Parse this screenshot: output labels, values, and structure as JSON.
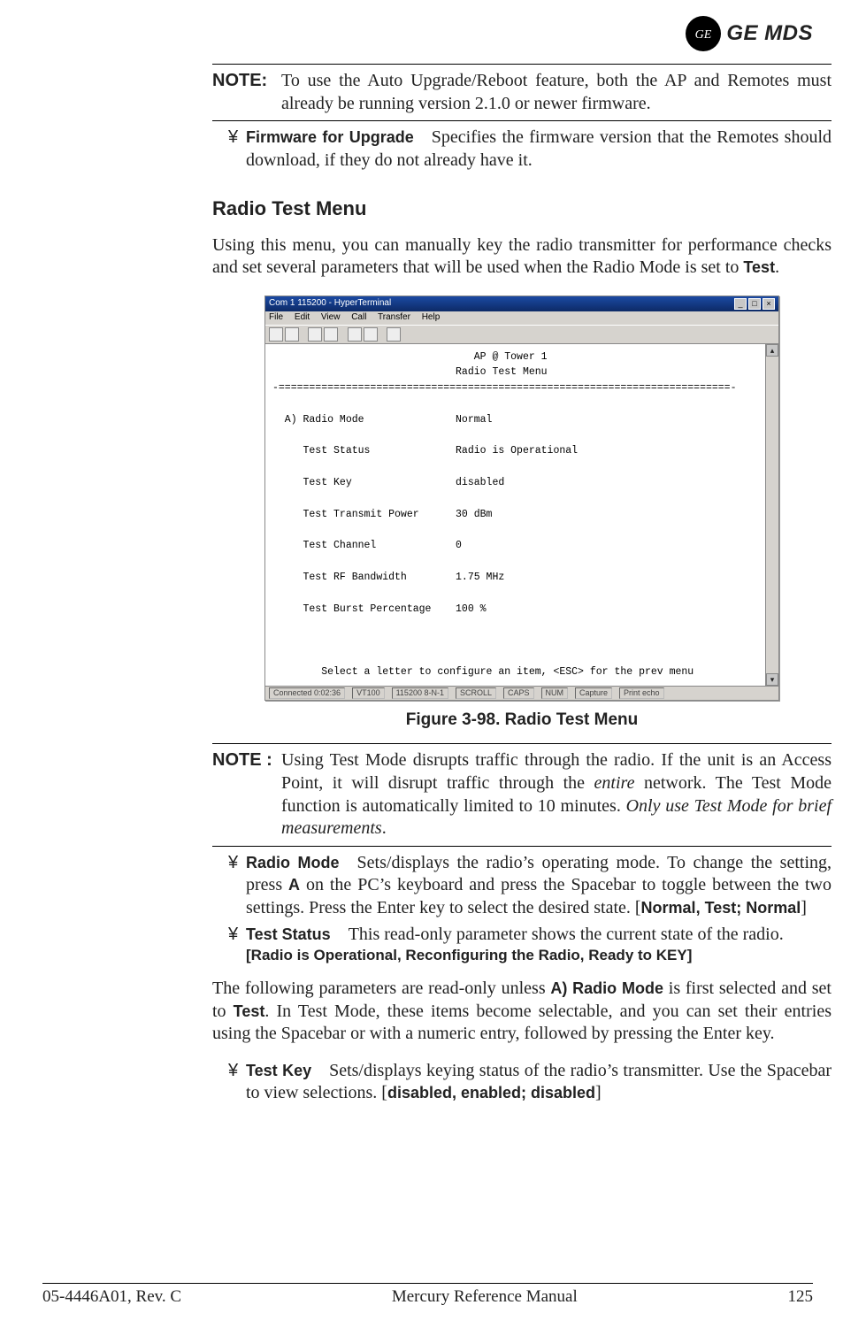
{
  "header": {
    "brand": "GE MDS"
  },
  "note1": {
    "label": "NOTE:",
    "text": "To use the Auto Upgrade/Reboot feature, both the AP and Remotes must already be running version 2.1.0 or newer firm­ware."
  },
  "bullet_fw": {
    "name": "Firmware for Upgrade",
    "desc": "Specifies the firmware version that the Remotes should download, if they do not already have it."
  },
  "section_heading": "Radio Test Menu",
  "intro_para_a": "Using this menu, you can manually key the radio transmitter for perfor­mance checks and set several parameters that will be used when the Radio Mode is set to ",
  "intro_para_bold": "Test",
  "intro_para_b": ".",
  "terminal": {
    "title": "Com 1 115200 - HyperTerminal",
    "menus": [
      "File",
      "Edit",
      "View",
      "Call",
      "Transfer",
      "Help"
    ],
    "header1": "AP @ Tower 1",
    "header2": "Radio Test Menu",
    "rows": [
      {
        "label": "A) Radio Mode",
        "value": "Normal"
      },
      {
        "label": "   Test Status",
        "value": "Radio is Operational"
      },
      {
        "label": "   Test Key",
        "value": "disabled"
      },
      {
        "label": "   Test Transmit Power",
        "value": "30 dBm"
      },
      {
        "label": "   Test Channel",
        "value": "0"
      },
      {
        "label": "   Test RF Bandwidth",
        "value": "1.75 MHz"
      },
      {
        "label": "   Test Burst Percentage",
        "value": "100 %"
      }
    ],
    "footer_line": "Select a letter to configure an item, <ESC> for the prev menu",
    "status": [
      "Connected 0:02:36",
      "VT100",
      "115200 8-N-1",
      "SCROLL",
      "CAPS",
      "NUM",
      "Capture",
      "Print echo"
    ]
  },
  "figure_caption": "Figure 3-98. Radio Test Menu",
  "note2": {
    "label": "NOTE :",
    "t1": "Using Test Mode disrupts traffic through the radio. If the unit is an Access Point, it will disrupt traffic through the ",
    "italic1": "entire",
    "t2": " network. The Test Mode function is automatically limited to 10 minutes. ",
    "italic2": "Only use Test Mode for brief measurements",
    "t3": "."
  },
  "bullet_radio_mode": {
    "name": "Radio Mode",
    "d1": "Sets/displays the radio’s operating mode. To change the setting, press ",
    "key": "A",
    "d2": " on the PC’s keyboard and press the Spacebar to toggle between the two settings. Press the Enter key to select the desired state. [",
    "vals": "Normal, Test; Normal",
    "d3": "]"
  },
  "bullet_test_status": {
    "name": "Test Status",
    "d1": "This read-only parameter shows the current state of the radio.",
    "vals": "[Radio is Operational, Reconfiguring the Radio, Ready to KEY]"
  },
  "mid_para_a": "The following parameters are read-only unless ",
  "mid_bold1": "A) Radio Mode",
  "mid_para_b": " is first selected and set to ",
  "mid_bold2": "Test",
  "mid_para_c": ". In Test Mode, these items become selectable, and you can set their entries using the Spacebar or with a numeric entry, followed by pressing the Enter key.",
  "bullet_test_key": {
    "name": "Test Key",
    "d1": "Sets/displays keying status of the radio’s transmitter. Use the Spacebar to view selections. [",
    "vals": "disabled, enabled; disabled",
    "d2": "]"
  },
  "footer": {
    "left": "05-4446A01, Rev. C",
    "center": "Mercury Reference Manual",
    "right": "125"
  }
}
